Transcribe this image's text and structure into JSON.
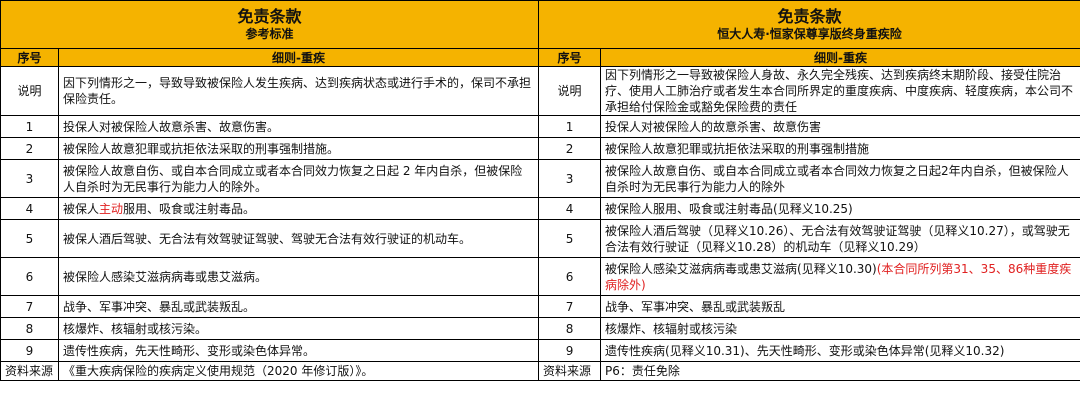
{
  "left": {
    "title": "免责条款",
    "subtitle": "参考标准",
    "col_no": "序号",
    "col_detail": "细则-重疾",
    "rows": [
      {
        "no": "说明",
        "parts": [
          {
            "text": "因下列情形之一，导致导致被保险人发生疾病、达到疾病状态或进行手术的，保司不承担保险责任。"
          }
        ]
      },
      {
        "no": "1",
        "parts": [
          {
            "text": "投保人对被保险人故意杀害、故意伤害。"
          }
        ]
      },
      {
        "no": "2",
        "parts": [
          {
            "text": "被保险人故意犯罪或抗拒依法采取的刑事强制措施。"
          }
        ]
      },
      {
        "no": "3",
        "parts": [
          {
            "text": "被保险人故意自伤、或自本合同成立或者本合同效力恢复之日起 2 年内自杀，但被保险人自杀时为无民事行为能力人的除外。"
          }
        ]
      },
      {
        "no": "4",
        "parts": [
          {
            "text": "被保人"
          },
          {
            "text": "主动",
            "red": true
          },
          {
            "text": "服用、吸食或注射毒品。"
          }
        ]
      },
      {
        "no": "5",
        "parts": [
          {
            "text": "被保人酒后驾驶、无合法有效驾驶证驾驶、驾驶无合法有效行驶证的机动车。"
          }
        ]
      },
      {
        "no": "6",
        "parts": [
          {
            "text": "被保险人感染艾滋病病毒或患艾滋病。"
          }
        ]
      },
      {
        "no": "7",
        "parts": [
          {
            "text": "战争、军事冲突、暴乱或武装叛乱。"
          }
        ]
      },
      {
        "no": "8",
        "parts": [
          {
            "text": "核爆炸、核辐射或核污染。"
          }
        ]
      },
      {
        "no": "9",
        "parts": [
          {
            "text": "遗传性疾病，先天性畸形、变形或染色体异常。"
          }
        ]
      }
    ],
    "source_label": "资料来源",
    "source_value": "《重大疾病保险的疾病定义使用规范（2020 年修订版）》。"
  },
  "right": {
    "title": "免责条款",
    "subtitle": "恒大人寿·恒家保尊享版终身重疾险",
    "col_no": "序号",
    "col_detail": "细则-重疾",
    "rows": [
      {
        "no": "说明",
        "parts": [
          {
            "text": "因下列情形之一导致被保险人身故、永久完全残疾、达到疾病终末期阶段、接受住院治疗、使用人工肺治疗或者发生本合同所界定的重度疾病、中度疾病、轻度疾病，本公司不承担给付保险金或豁免保险费的责任"
          }
        ]
      },
      {
        "no": "1",
        "parts": [
          {
            "text": "投保人对被保险人的故意杀害、故意伤害"
          }
        ]
      },
      {
        "no": "2",
        "parts": [
          {
            "text": "被保险人故意犯罪或抗拒依法采取的刑事强制措施"
          }
        ]
      },
      {
        "no": "3",
        "parts": [
          {
            "text": "被保险人故意自伤、或自本合同成立或者本合同效力恢复之日起2年内自杀，但被保险人自杀时为无民事行为能力人的除外"
          }
        ]
      },
      {
        "no": "4",
        "parts": [
          {
            "text": "被保险人服用、吸食或注射毒品(见释义10.25)"
          }
        ]
      },
      {
        "no": "5",
        "parts": [
          {
            "text": "被保险人酒后驾驶（见释义10.26）、无合法有效驾驶证驾驶（见释义10.27），或驾驶无合法有效行驶证（见释义10.28）的机动车（见释义10.29）"
          }
        ]
      },
      {
        "no": "6",
        "parts": [
          {
            "text": "被保险人感染艾滋病病毒或患艾滋病(见释义10.30)"
          },
          {
            "text": "(本合同所列第31、35、86种重度疾病除外)",
            "red": true
          }
        ]
      },
      {
        "no": "7",
        "parts": [
          {
            "text": "战争、军事冲突、暴乱或武装叛乱"
          }
        ]
      },
      {
        "no": "8",
        "parts": [
          {
            "text": "核爆炸、核辐射或核污染"
          }
        ]
      },
      {
        "no": "9",
        "parts": [
          {
            "text": "遗传性疾病(见释义10.31)、先天性畸形、变形或染色体异常(见释义10.32)"
          }
        ]
      }
    ],
    "source_label": "资料来源",
    "source_value": "P6：责任免除"
  },
  "colors": {
    "header_bg": "#f5b300",
    "highlight": "#e02020"
  }
}
